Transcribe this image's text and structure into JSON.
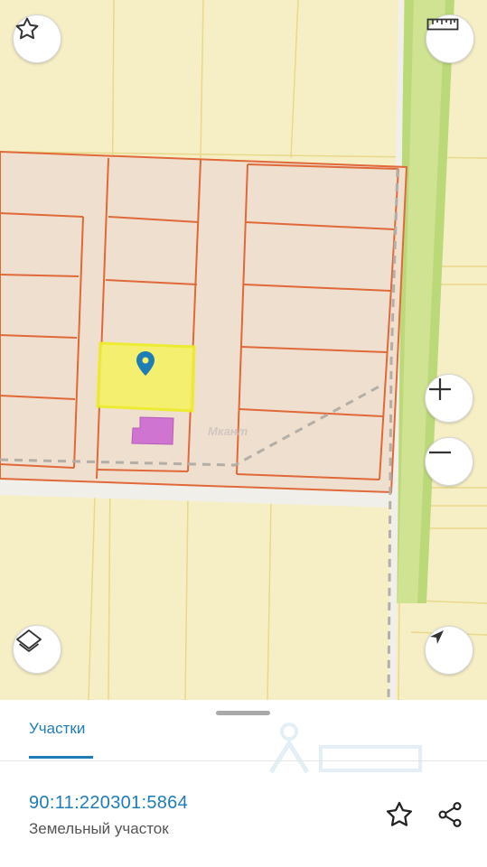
{
  "map": {
    "watermark_text": "Мкант",
    "colors": {
      "background": "#f6efc6",
      "parcel_fill": "#efdfcf",
      "parcel_border": "#e0693a",
      "grid_line": "#e8d88a",
      "green_strip": "#bcd97a",
      "selected_fill": "#f6f06b",
      "selected_border": "#ecec2a",
      "building": "#cf74d1",
      "marker": "#1f7db5"
    },
    "icons": {
      "favorite": "star-outline-icon",
      "ruler": "ruler-icon",
      "zoom_in": "plus-icon",
      "zoom_out": "minus-icon",
      "layers": "layers-icon",
      "locate": "navigation-arrow-icon",
      "marker": "map-pin-icon"
    }
  },
  "panel": {
    "tab_label": "Участки",
    "cadastral_number": "90:11:220301:5864",
    "parcel_type": "Земельный участок",
    "accent": "#1f7db5",
    "icons": {
      "favorite": "star-outline-icon",
      "share": "share-icon"
    }
  }
}
